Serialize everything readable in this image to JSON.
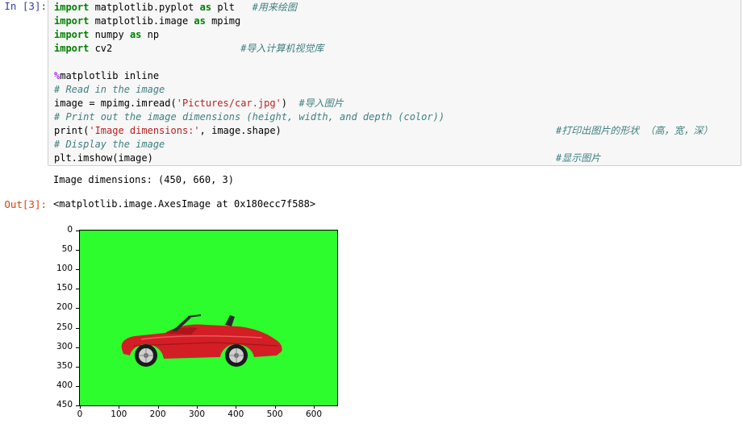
{
  "cell": {
    "in_prompt": "In [3]:",
    "out_prompt": "Out[3]:",
    "code_lines": [
      {
        "segments": [
          {
            "t": "kw",
            "v": "import"
          },
          {
            "t": "txt",
            "v": " matplotlib.pyplot "
          },
          {
            "t": "kw",
            "v": "as"
          },
          {
            "t": "txt",
            "v": " plt   "
          },
          {
            "t": "cm",
            "v": "#用来绘图"
          }
        ]
      },
      {
        "segments": [
          {
            "t": "kw",
            "v": "import"
          },
          {
            "t": "txt",
            "v": " matplotlib.image "
          },
          {
            "t": "kw",
            "v": "as"
          },
          {
            "t": "txt",
            "v": " mpimg"
          }
        ]
      },
      {
        "segments": [
          {
            "t": "kw",
            "v": "import"
          },
          {
            "t": "txt",
            "v": " numpy "
          },
          {
            "t": "kw",
            "v": "as"
          },
          {
            "t": "txt",
            "v": " np"
          }
        ]
      },
      {
        "segments": [
          {
            "t": "kw",
            "v": "import"
          },
          {
            "t": "txt",
            "v": " cv2                      "
          },
          {
            "t": "cm",
            "v": "#导入计算机视觉库"
          }
        ]
      },
      {
        "segments": []
      },
      {
        "segments": [
          {
            "t": "mg",
            "v": "%"
          },
          {
            "t": "txt",
            "v": "matplotlib inline"
          }
        ]
      },
      {
        "segments": [
          {
            "t": "cm",
            "v": "# Read in the image"
          }
        ]
      },
      {
        "segments": [
          {
            "t": "txt",
            "v": "image = mpimg.imread("
          },
          {
            "t": "str",
            "v": "'Pictures/car.jpg'"
          },
          {
            "t": "txt",
            "v": ")  "
          },
          {
            "t": "cm",
            "v": "#导入图片"
          }
        ]
      },
      {
        "segments": [
          {
            "t": "cm",
            "v": "# Print out the image dimensions (height, width, and depth (color))"
          }
        ]
      },
      {
        "segments": [
          {
            "t": "txt",
            "v": "print("
          },
          {
            "t": "str",
            "v": "'Image dimensions:'"
          },
          {
            "t": "txt",
            "v": ", image.shape)"
          }
        ],
        "right_comment": "#打印出图片的形状 （高，宽，深）"
      },
      {
        "segments": [
          {
            "t": "cm",
            "v": "# Display the image"
          }
        ]
      },
      {
        "segments": [
          {
            "t": "txt",
            "v": "plt.imshow(image)"
          }
        ],
        "right_comment": "#显示图片"
      }
    ],
    "stdout": "Image dimensions: (450, 660, 3)",
    "out_repr": "<matplotlib.image.AxesImage at 0x180ecc7f588>"
  },
  "chart_data": {
    "type": "image",
    "title": "",
    "xlabel": "",
    "ylabel": "",
    "xlim": [
      0,
      660
    ],
    "ylim": [
      450,
      0
    ],
    "x_ticks": [
      0,
      100,
      200,
      300,
      400,
      500,
      600
    ],
    "y_ticks": [
      0,
      50,
      100,
      150,
      200,
      250,
      300,
      350,
      400,
      450
    ],
    "background_color": "#2dfd2d",
    "image_subject": "red-convertible-sports-car"
  }
}
